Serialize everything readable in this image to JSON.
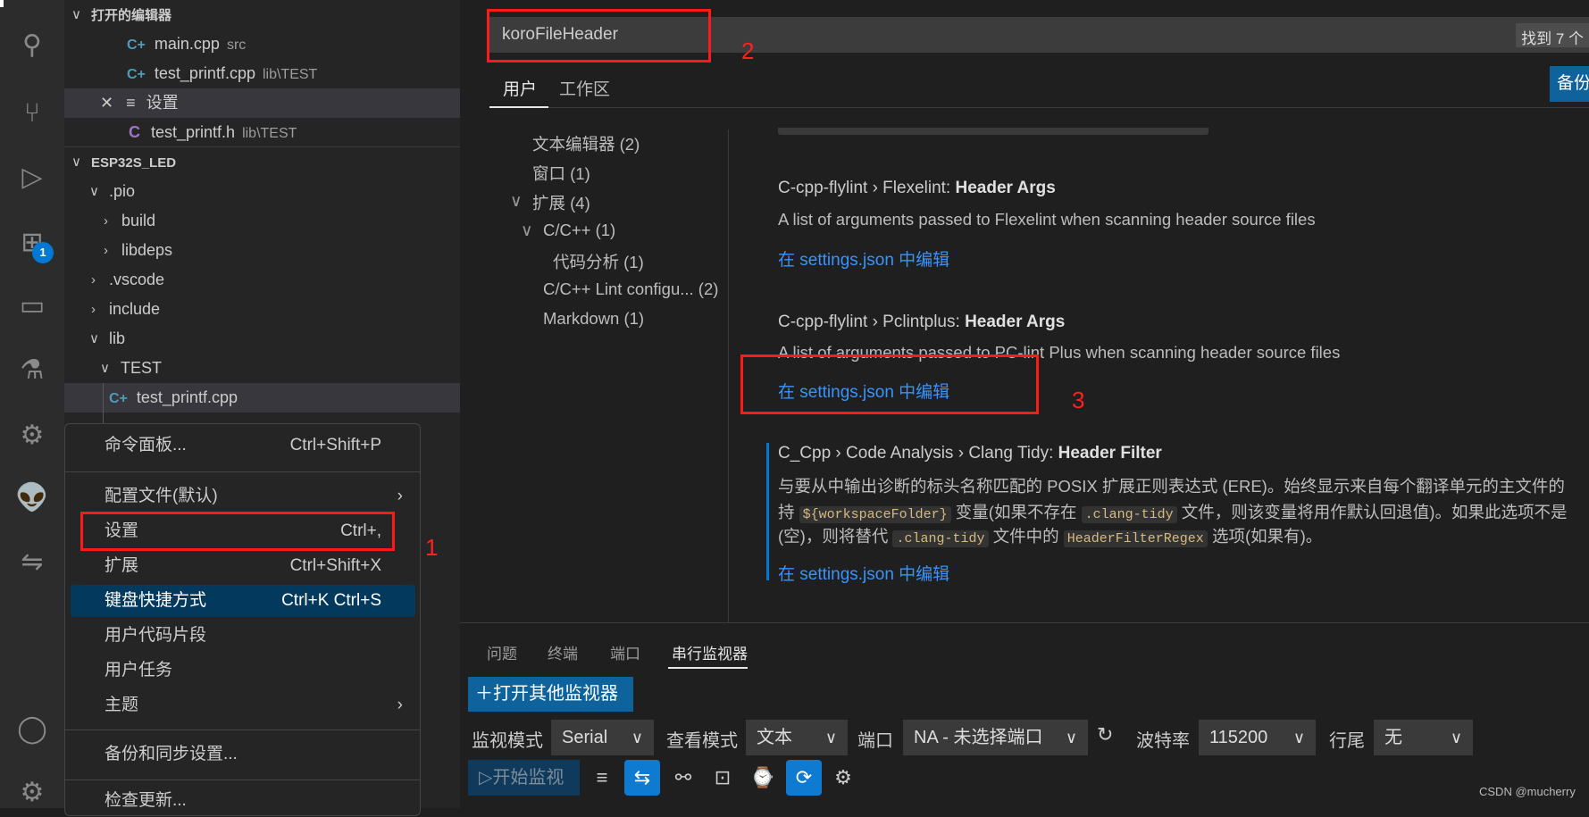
{
  "activity_bar": {
    "icons": [
      "explorer-icon",
      "search-icon",
      "source-control-icon",
      "run-debug-icon",
      "extensions-icon",
      "remote-explorer-icon",
      "testing-icon",
      "cpp-settings-icon",
      "platformio-icon",
      "live-share-icon",
      "account-icon",
      "manage-gear-icon"
    ],
    "extensions_badge": "1"
  },
  "sidebar": {
    "open_editors": {
      "title": "打开的编辑器",
      "items": [
        {
          "name": "main.cpp",
          "path": "src",
          "icon": "cpp"
        },
        {
          "name": "test_printf.cpp",
          "path": "lib\\TEST",
          "icon": "cpp"
        },
        {
          "name": "设置",
          "path": "",
          "icon": "settings"
        },
        {
          "name": "test_printf.h",
          "path": "lib\\TEST",
          "icon": "c"
        }
      ]
    },
    "project": {
      "title": "ESP32S_LED",
      "tree": [
        {
          "label": ".pio",
          "expanded": true
        },
        {
          "label": "build",
          "expanded": false
        },
        {
          "label": "libdeps",
          "expanded": false
        },
        {
          "label": ".vscode",
          "expanded": false
        },
        {
          "label": "include",
          "expanded": false
        },
        {
          "label": "lib",
          "expanded": true
        },
        {
          "label": "TEST",
          "expanded": true
        },
        {
          "label": "test_printf.cpp"
        }
      ]
    }
  },
  "menu": {
    "items": [
      {
        "label": "命令面板...",
        "shortcut": "Ctrl+Shift+P"
      },
      {
        "label": "配置文件(默认)",
        "shortcut": ""
      },
      {
        "label": "设置",
        "shortcut": "Ctrl+,"
      },
      {
        "label": "扩展",
        "shortcut": "Ctrl+Shift+X"
      },
      {
        "label": "键盘快捷方式",
        "shortcut": "Ctrl+K Ctrl+S"
      },
      {
        "label": "用户代码片段",
        "shortcut": ""
      },
      {
        "label": "用户任务",
        "shortcut": ""
      },
      {
        "label": "主题",
        "shortcut": ""
      },
      {
        "label": "备份和同步设置...",
        "shortcut": ""
      },
      {
        "label": "检查更新...",
        "shortcut": ""
      }
    ]
  },
  "annotations": {
    "one": "1",
    "two": "2",
    "three": "3",
    "color": "#ff1a1a"
  },
  "settings": {
    "search_value": "koroFileHeader",
    "found": "找到 7 个",
    "tabs": [
      "用户",
      "工作区"
    ],
    "backup_button": "备份",
    "toc": [
      {
        "label": "文本编辑器 (2)"
      },
      {
        "label": "窗口 (1)"
      },
      {
        "label": "扩展 (4)"
      },
      {
        "label": "C/C++ (1)"
      },
      {
        "label": "代码分析 (1)"
      },
      {
        "label": "C/C++ Lint configu... (2)"
      },
      {
        "label": "Markdown (1)"
      }
    ],
    "items": [
      {
        "prefix": "C-cpp-flylint › Flexelint: ",
        "name": "Header Args",
        "desc": "A list of arguments passed to Flexelint when scanning header source files",
        "link": "在 settings.json 中编辑"
      },
      {
        "prefix": "C-cpp-flylint › Pclintplus: ",
        "name": "Header Args",
        "desc": "A list of arguments passed to PC-lint Plus when scanning header source files",
        "link": "在 settings.json 中编辑"
      },
      {
        "prefix": "C_Cpp › Code Analysis › Clang Tidy: ",
        "name": "Header Filter",
        "desc1": "与要从中输出诊断的标头名称匹配的 POSIX 扩展正则表达式 (ERE)。始终显示来自每个翻译单元的主文件的",
        "desc2a": "持 ",
        "code1": "${workspaceFolder}",
        "desc2b": " 变量(如果不存在 ",
        "code2": ".clang-tidy",
        "desc2c": " 文件，则该变量将用作默认回退值)。如果此选项不是",
        "desc3a": "(空)，则将替代 ",
        "code3": ".clang-tidy",
        "desc3b": " 文件中的 ",
        "code4": "HeaderFilterRegex",
        "desc3c": " 选项(如果有)。",
        "link": "在 settings.json 中编辑"
      }
    ]
  },
  "panel": {
    "tabs": [
      "问题",
      "终端",
      "端口",
      "串行监视器"
    ],
    "active_tab": "串行监视器",
    "open_other": "打开其他监视器",
    "monitor_mode_label": "监视模式",
    "monitor_mode": "Serial",
    "view_mode_label": "查看模式",
    "view_mode": "文本",
    "port_label": "端口",
    "port": "NA - 未选择端口",
    "baud_label": "波特率",
    "baud": "115200",
    "line_ending_label": "行尾",
    "line_ending": "无",
    "start_button": "开始监视",
    "toolbar_icons": [
      "clear-output-icon",
      "toggle-line-wrap-icon",
      "connect-icon",
      "terminal-icon",
      "timestamp-icon",
      "auto-scroll-icon",
      "settings-gear-icon"
    ]
  },
  "watermark": "CSDN @mucherry"
}
